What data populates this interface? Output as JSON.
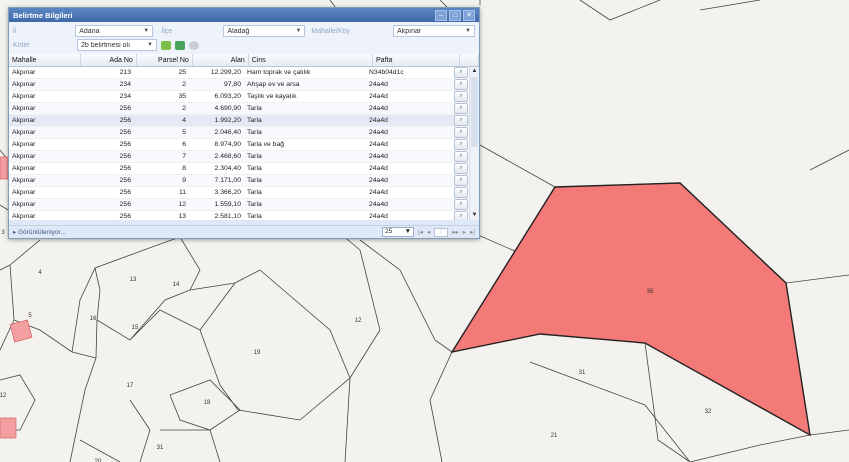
{
  "window": {
    "title": "Belirtme Bilgileri"
  },
  "filters": {
    "il_label": "İl",
    "il_value": "Adana",
    "ilce_label": "İlçe",
    "ilce_value": "Aladağ",
    "mahalle_label": "Mahalle/Köy",
    "mahalle_value": "Akpınar",
    "kriter_label": "Kriter",
    "kriter_value": "2b belirtmesi olı"
  },
  "columns": [
    "Mahalle",
    "Ada No",
    "Parsel No",
    "Alan",
    "Cins",
    "Pafta"
  ],
  "rows": [
    [
      "Akpınar",
      "213",
      "25",
      "12.299,20",
      "Ham toprak ve çalılık",
      "N34b04d1c"
    ],
    [
      "Akpınar",
      "234",
      "2",
      "97,80",
      "Ahşap ev ve arsa",
      "24a4d"
    ],
    [
      "Akpınar",
      "234",
      "35",
      "6.093,20",
      "Taşlık ve kayalık",
      "24a4d"
    ],
    [
      "Akpınar",
      "256",
      "2",
      "4.690,90",
      "Tarla",
      "24a4d"
    ],
    [
      "Akpınar",
      "256",
      "4",
      "1.992,20",
      "Tarla",
      "24a4d"
    ],
    [
      "Akpınar",
      "256",
      "5",
      "2.046,40",
      "Tarla",
      "24a4d"
    ],
    [
      "Akpınar",
      "256",
      "6",
      "8.974,90",
      "Tarla ve bağ",
      "24a4d"
    ],
    [
      "Akpınar",
      "256",
      "7",
      "2.468,60",
      "Tarla",
      "24a4d"
    ],
    [
      "Akpınar",
      "256",
      "8",
      "2.304,40",
      "Tarla",
      "24a4d"
    ],
    [
      "Akpınar",
      "256",
      "9",
      "7.171,00",
      "Tarla",
      "24a4d"
    ],
    [
      "Akpınar",
      "256",
      "11",
      "3.366,20",
      "Tarla",
      "24a4d"
    ],
    [
      "Akpınar",
      "256",
      "12",
      "1.559,10",
      "Tarla",
      "24a4d"
    ],
    [
      "Akpınar",
      "256",
      "13",
      "2.581,10",
      "Tarla",
      "24a4d"
    ]
  ],
  "footer": {
    "status": "Görüntüleniyor...",
    "page_size": "25",
    "page": "1"
  },
  "map": {
    "highlight_color": "#f47a78",
    "labels": [
      "35",
      "31",
      "32",
      "21",
      "12",
      "19",
      "17",
      "18",
      "13",
      "14",
      "15",
      "16",
      "4",
      "5",
      "12",
      "31",
      "20",
      "3"
    ]
  }
}
